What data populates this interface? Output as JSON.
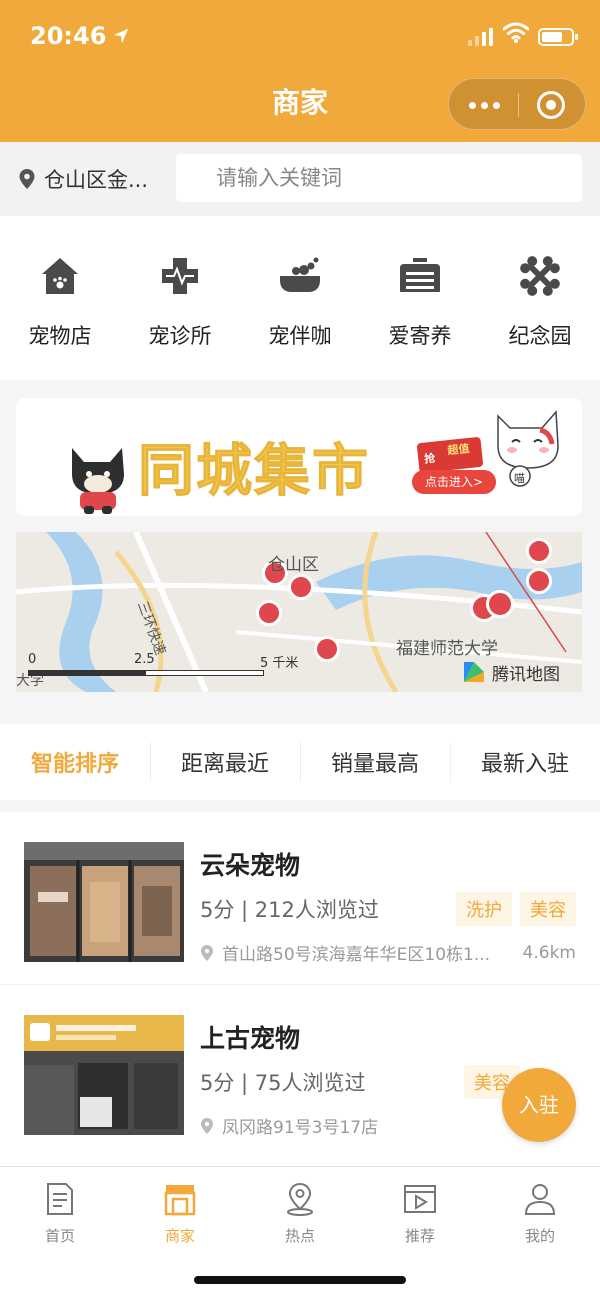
{
  "status_bar": {
    "time": "20:46"
  },
  "header": {
    "title": "商家"
  },
  "search": {
    "location": "仓山区金...",
    "placeholder": "请输入关键词"
  },
  "categories": [
    {
      "label": "宠物店",
      "icon": "pet-house-icon"
    },
    {
      "label": "宠诊所",
      "icon": "medical-cross-icon"
    },
    {
      "label": "宠伴咖",
      "icon": "pet-bath-icon"
    },
    {
      "label": "爱寄养",
      "icon": "pet-carrier-icon"
    },
    {
      "label": "纪念园",
      "icon": "bone-cross-icon"
    }
  ],
  "banner": {
    "title": "同城集市",
    "small_top": "抢",
    "small_label": "超值",
    "button": "点击进入>",
    "cat_text": "喵"
  },
  "map": {
    "labels": {
      "district": "仓山区",
      "university": "福建师范大学",
      "road": "三环快速",
      "corner": "大学",
      "brand": "腾讯地图"
    },
    "scale": {
      "zero": "0",
      "mid": "2.5",
      "end": "5 千米"
    }
  },
  "sort_tabs": [
    {
      "label": "智能排序",
      "active": true
    },
    {
      "label": "距离最近",
      "active": false
    },
    {
      "label": "销量最高",
      "active": false
    },
    {
      "label": "最新入驻",
      "active": false
    }
  ],
  "shops": [
    {
      "name": "云朵宠物",
      "meta": "5分 | 212人浏览过",
      "tags": [
        "洗护",
        "美容"
      ],
      "address": "首山路50号滨海嘉年华E区10栋1...",
      "distance": "4.6km"
    },
    {
      "name": "上古宠物",
      "meta": "5分 | 75人浏览过",
      "tags": [
        "美容"
      ],
      "address": "凤冈路91号3号17店",
      "distance": ""
    }
  ],
  "fab": {
    "label": "入驻"
  },
  "bottom_nav": [
    {
      "label": "首页",
      "icon": "document-icon",
      "active": false
    },
    {
      "label": "商家",
      "icon": "shop-icon",
      "active": true
    },
    {
      "label": "热点",
      "icon": "location-pin-icon",
      "active": false
    },
    {
      "label": "推荐",
      "icon": "video-play-icon",
      "active": false
    },
    {
      "label": "我的",
      "icon": "user-icon",
      "active": false
    }
  ],
  "colors": {
    "brand": "#F2A93B",
    "map_pin": "#E0474C"
  }
}
